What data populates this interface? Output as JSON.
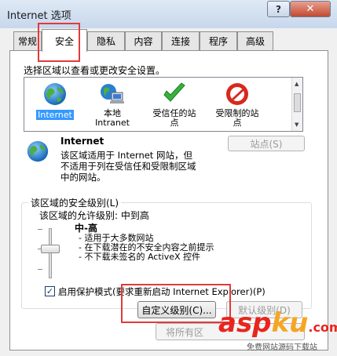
{
  "window": {
    "title": "Internet 选项",
    "help": "?",
    "close": "✕"
  },
  "tabs": [
    {
      "label": "常规"
    },
    {
      "label": "安全"
    },
    {
      "label": "隐私"
    },
    {
      "label": "内容"
    },
    {
      "label": "连接"
    },
    {
      "label": "程序"
    },
    {
      "label": "高级"
    }
  ],
  "zones": {
    "prompt": "选择区域以查看或更改安全设置。",
    "items": [
      {
        "label": "Internet",
        "icon": "globe-icon"
      },
      {
        "label": "本地\nIntranet",
        "icon": "intranet-icon"
      },
      {
        "label": "受信任的站\n点",
        "icon": "checkmark-icon"
      },
      {
        "label": "受限制的站\n点",
        "icon": "no-entry-icon"
      }
    ]
  },
  "selected_zone": {
    "title": "Internet",
    "description": "该区域适用于 Internet 网站，但\n不适用于列在受信任和受限制区域\n中的网站。",
    "sites_button": "站点(S)"
  },
  "security_level": {
    "group_title": "该区域的安全级别(L)",
    "allowed_levels": "该区域的允许级别: 中到高",
    "level_name": "中-高",
    "level_desc": "- 适用于大多数网站\n- 在下载潜在的不安全内容之前提示\n- 不下载未签名的 ActiveX 控件",
    "protected_mode_checked": true,
    "protected_mode_label": "启用保护模式(要求重新启动 Internet Explorer)(P)",
    "custom_button": "自定义级别(C)...",
    "default_button": "默认级别(D)"
  },
  "reset_all_button": "将所有区",
  "watermark": {
    "logo_a": "asp",
    "logo_b": "ku",
    "logo_c": ".com",
    "caption": "免费网站源码下载站"
  },
  "colors": {
    "highlight": "#e33a3a",
    "selection": "#3399ff"
  }
}
